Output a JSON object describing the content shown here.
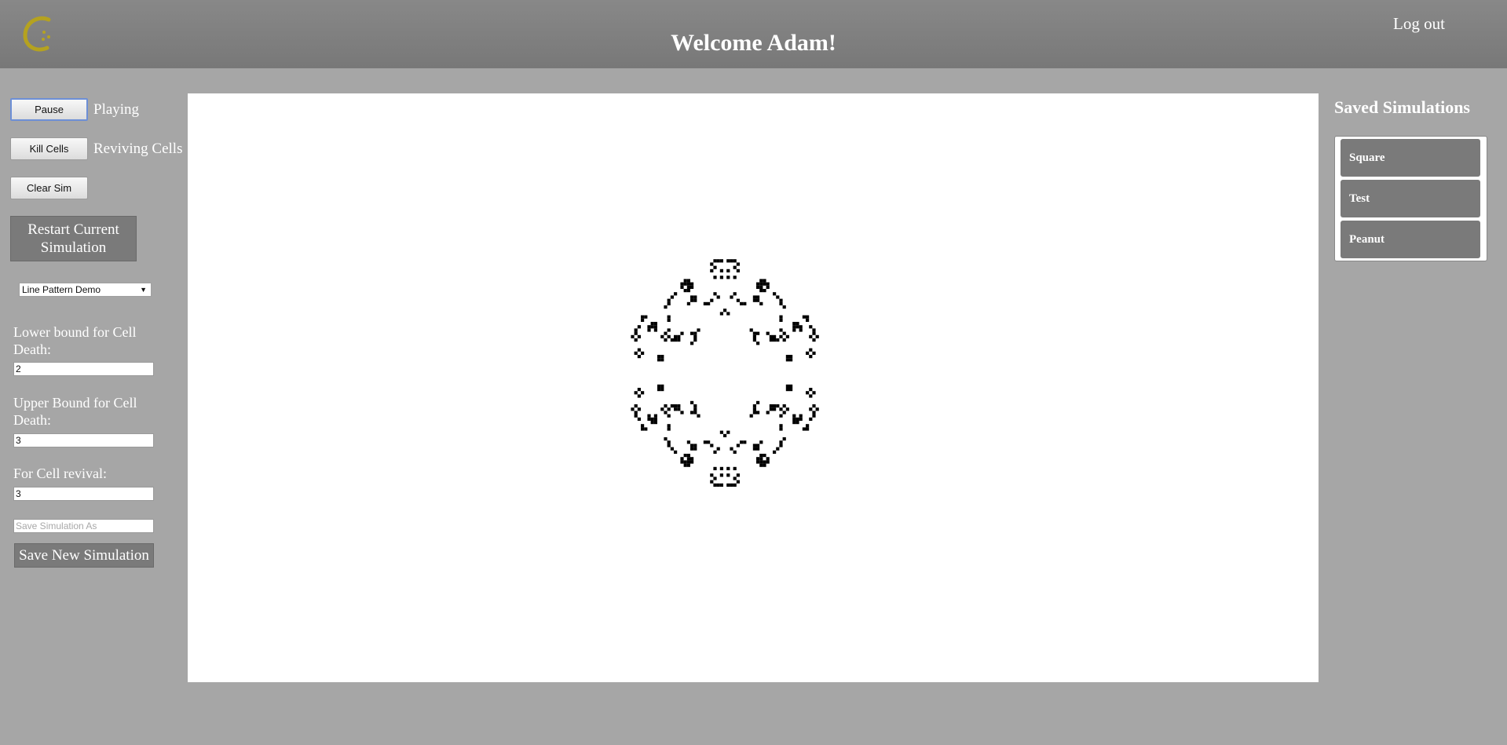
{
  "header": {
    "title": "Welcome Adam!",
    "logout_label": "Log out",
    "logo_icon": "game-of-life-logo-icon",
    "logo_color": "#b5a21f"
  },
  "controls": {
    "pause_label": "Pause",
    "play_status": "Playing",
    "kill_label": "Kill Cells",
    "kill_status": "Reviving Cells",
    "clear_label": "Clear Sim",
    "restart_label": "Restart Current Simulation",
    "pattern_select": {
      "selected": "Line Pattern Demo"
    }
  },
  "rules": {
    "lower_label": "Lower bound for Cell Death:",
    "lower_value": "2",
    "upper_label": "Upper Bound for Cell Death:",
    "upper_value": "3",
    "revival_label": "For Cell revival:",
    "revival_value": "3"
  },
  "save": {
    "name_placeholder": "Save Simulation As",
    "save_label": "Save New Simulation"
  },
  "saved": {
    "title": "Saved Simulations",
    "items": [
      {
        "label": "Square"
      },
      {
        "label": "Test"
      },
      {
        "label": "Peanut"
      }
    ]
  },
  "colors": {
    "background": "#a6a6a6",
    "header": "#808080",
    "dark_button": "#7a7a7a",
    "cell": "#000000",
    "board": "#ffffff"
  }
}
